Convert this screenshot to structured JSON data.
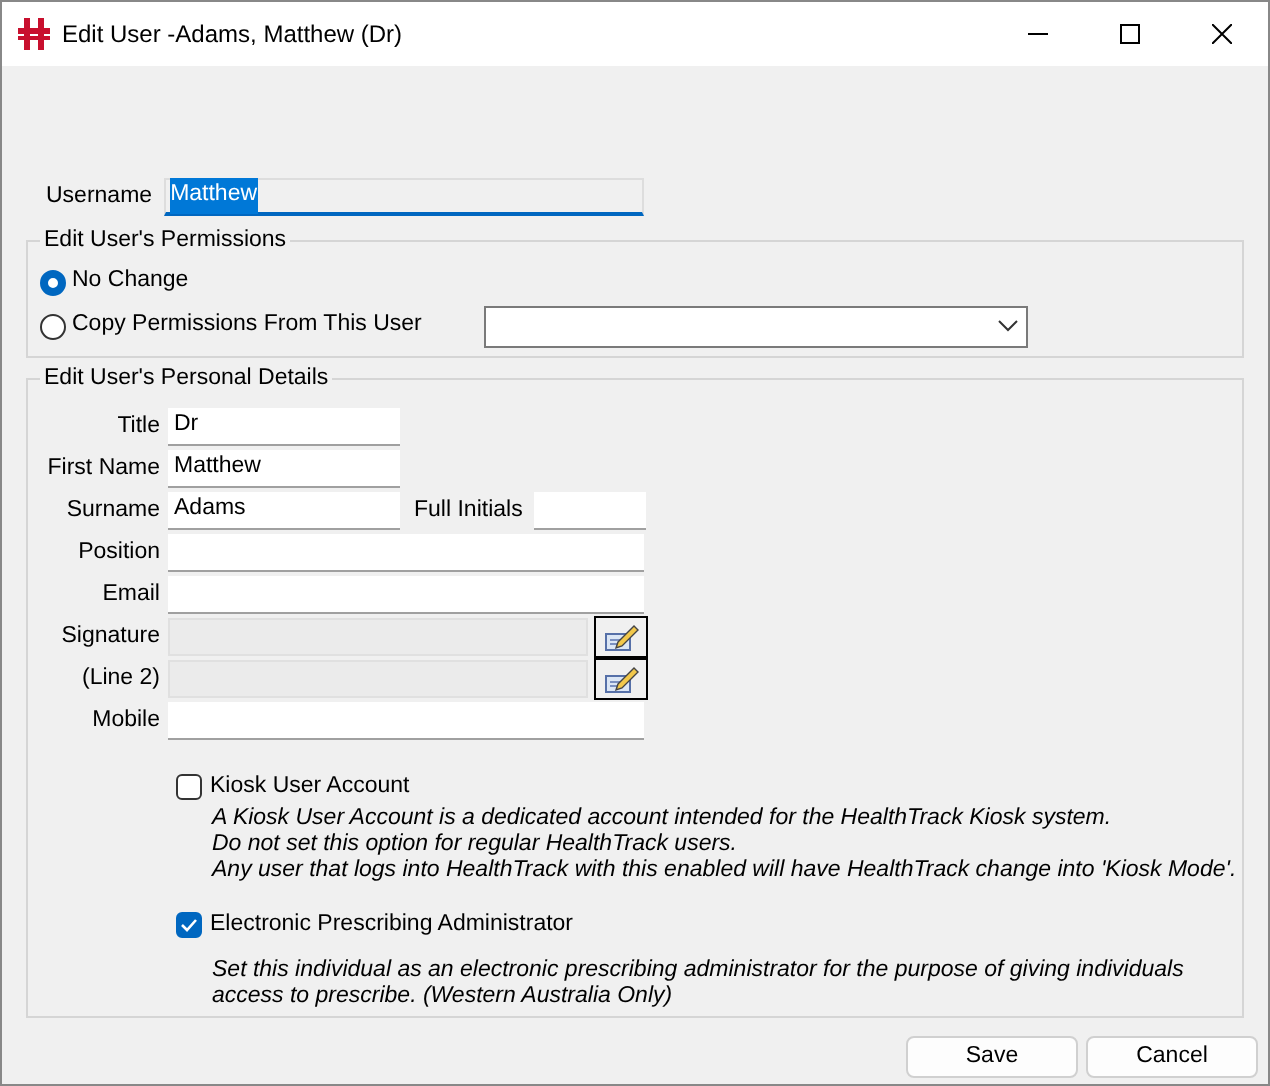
{
  "window": {
    "title": "Edit User -Adams, Matthew (Dr)"
  },
  "username": {
    "label": "Username",
    "value": "Matthew",
    "text_selected": true
  },
  "permissions": {
    "title": "Edit User's Permissions",
    "options": [
      {
        "label": "No Change",
        "selected": true
      },
      {
        "label": "Copy Permissions From This User",
        "selected": false,
        "kind": "with_dropdown"
      }
    ]
  },
  "personal_details": {
    "title": "Edit User's Personal Details",
    "fields": [
      {
        "label": "Title",
        "value": "Dr",
        "kind": "short"
      },
      {
        "label": "First Name",
        "value": "Matthew",
        "kind": "short"
      },
      {
        "label": "Surname",
        "value": "Adams",
        "kind": "short",
        "extra_label": "Full Initials"
      },
      {
        "label": "Position",
        "kind": "long"
      },
      {
        "label": "Email",
        "kind": "long"
      },
      {
        "label": "Signature",
        "kind": "signature",
        "disabled": true
      },
      {
        "label": "(Line 2)",
        "kind": "signature",
        "disabled": true
      },
      {
        "label": "Mobile",
        "kind": "long"
      }
    ],
    "options": [
      {
        "label": "Kiosk User Account",
        "checked": false,
        "description": [
          "A Kiosk User Account is a dedicated account intended for the HealthTrack Kiosk system.",
          "Do not set this option for regular HealthTrack users.",
          "Any user that logs into HealthTrack with this enabled will have HealthTrack change into 'Kiosk Mode'."
        ]
      },
      {
        "label": "Electronic Prescribing Administrator",
        "checked": true,
        "description": [
          "Set this individual as an electronic prescribing administrator for the purpose of giving individuals access to prescribe. (Western Australia Only)"
        ]
      }
    ]
  },
  "buttons": [
    {
      "label": "Save"
    },
    {
      "label": "Cancel"
    }
  ]
}
